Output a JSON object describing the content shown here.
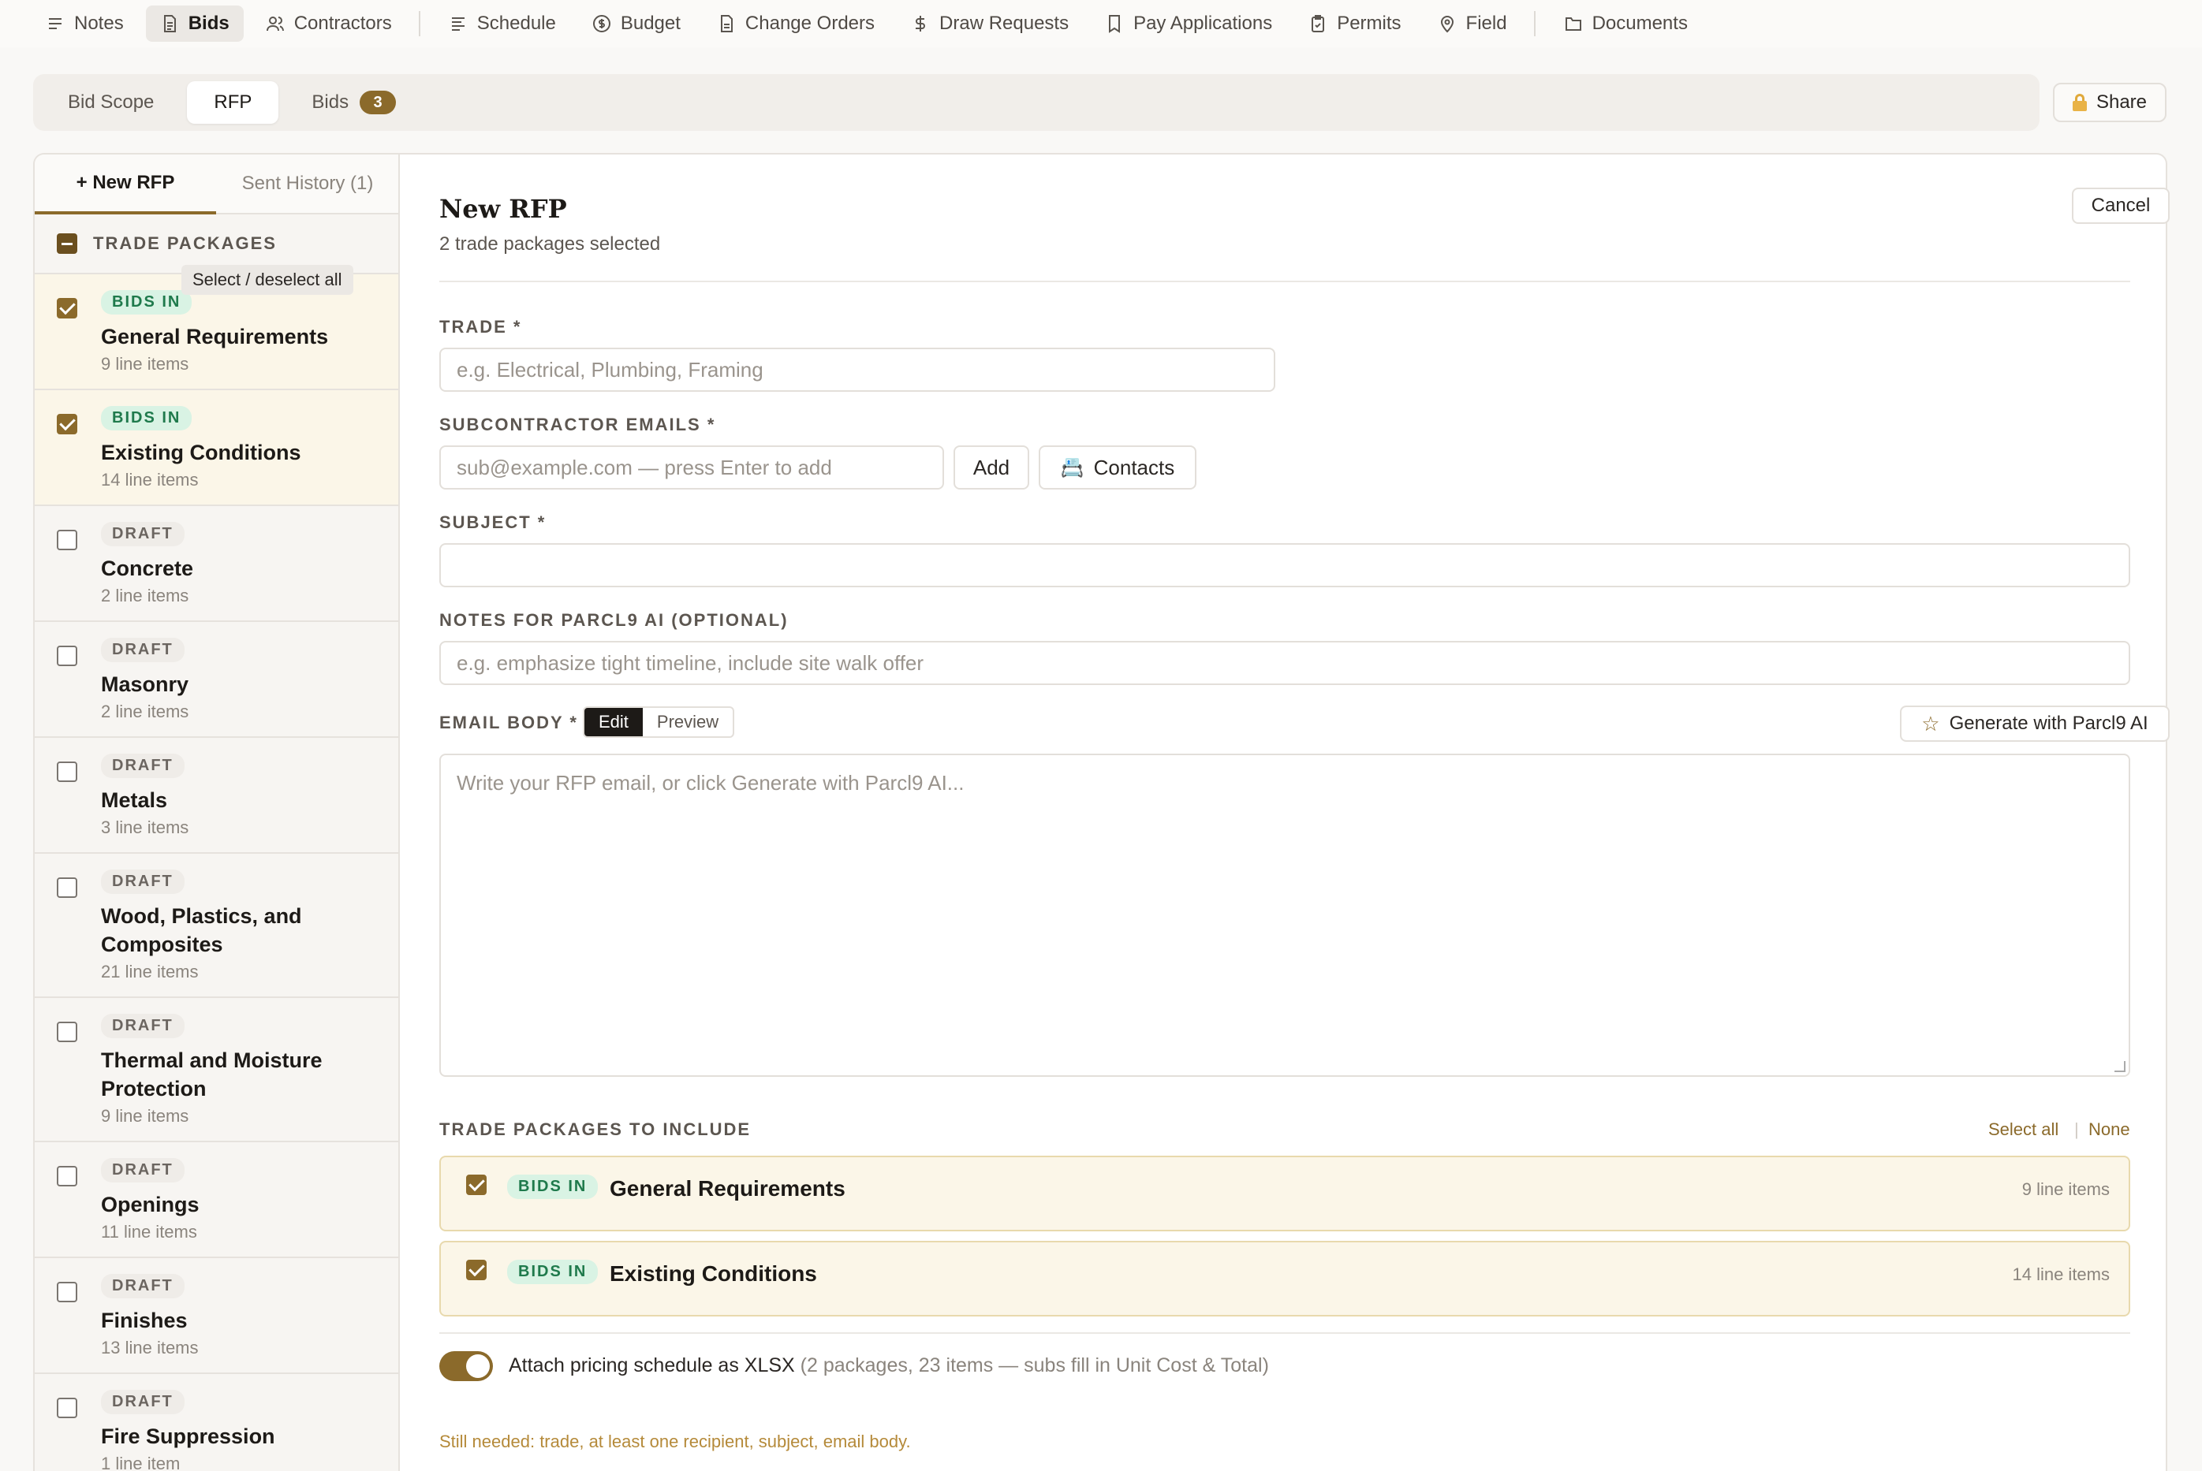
{
  "nav": {
    "items": [
      {
        "label": "Notes",
        "icon": "menu-lines-icon"
      },
      {
        "label": "Bids",
        "icon": "document-icon",
        "active": true
      },
      {
        "label": "Contractors",
        "icon": "users-icon"
      },
      {
        "label": "Schedule",
        "icon": "schedule-lines-icon"
      },
      {
        "label": "Budget",
        "icon": "dollar-circle-icon"
      },
      {
        "label": "Change Orders",
        "icon": "file-icon"
      },
      {
        "label": "Draw Requests",
        "icon": "dollar-icon"
      },
      {
        "label": "Pay Applications",
        "icon": "receipt-icon"
      },
      {
        "label": "Permits",
        "icon": "clipboard-icon"
      },
      {
        "label": "Field",
        "icon": "map-pin-icon"
      },
      {
        "label": "Documents",
        "icon": "folder-icon"
      }
    ]
  },
  "subtabs": {
    "bid_scope": "Bid Scope",
    "rfp": "RFP",
    "bids": "Bids",
    "bids_count": "3"
  },
  "share": {
    "label": "Share"
  },
  "left": {
    "tab_new": "+ New RFP",
    "tab_history": "Sent History (1)",
    "header": "TRADE PACKAGES",
    "tooltip": "Select / deselect all",
    "packages": [
      {
        "status": "BIDS IN",
        "name": "General Requirements",
        "count": "9 line items",
        "checked": true
      },
      {
        "status": "BIDS IN",
        "name": "Existing Conditions",
        "count": "14 line items",
        "checked": true
      },
      {
        "status": "DRAFT",
        "name": "Concrete",
        "count": "2 line items",
        "checked": false
      },
      {
        "status": "DRAFT",
        "name": "Masonry",
        "count": "2 line items",
        "checked": false
      },
      {
        "status": "DRAFT",
        "name": "Metals",
        "count": "3 line items",
        "checked": false
      },
      {
        "status": "DRAFT",
        "name": "Wood, Plastics, and Composites",
        "count": "21 line items",
        "checked": false
      },
      {
        "status": "DRAFT",
        "name": "Thermal and Moisture Protection",
        "count": "9 line items",
        "checked": false
      },
      {
        "status": "DRAFT",
        "name": "Openings",
        "count": "11 line items",
        "checked": false
      },
      {
        "status": "DRAFT",
        "name": "Finishes",
        "count": "13 line items",
        "checked": false
      },
      {
        "status": "DRAFT",
        "name": "Fire Suppression",
        "count": "1 line item",
        "checked": false
      }
    ]
  },
  "form": {
    "title": "New RFP",
    "subtitle": "2 trade packages selected",
    "cancel": "Cancel",
    "trade_label": "TRADE *",
    "trade_placeholder": "e.g. Electrical, Plumbing, Framing",
    "emails_label": "SUBCONTRACTOR EMAILS *",
    "emails_placeholder": "sub@example.com — press Enter to add",
    "add_button": "Add",
    "contacts_button": "Contacts",
    "subject_label": "SUBJECT *",
    "subject_value": "",
    "notes_label": "NOTES FOR PARCL9 AI (OPTIONAL)",
    "notes_placeholder": "e.g. emphasize tight timeline, include site walk offer",
    "body_label": "EMAIL BODY *",
    "edit_tab": "Edit",
    "preview_tab": "Preview",
    "generate_button": "Generate with Parcl9 AI",
    "body_placeholder": "Write your RFP email, or click Generate with Parcl9 AI...",
    "include_label": "TRADE PACKAGES TO INCLUDE",
    "select_all": "Select all",
    "select_none": "None",
    "included": [
      {
        "status": "BIDS IN",
        "name": "General Requirements",
        "count": "9 line items"
      },
      {
        "status": "BIDS IN",
        "name": "Existing Conditions",
        "count": "14 line items"
      }
    ],
    "attach_label": "Attach pricing schedule as XLSX",
    "attach_detail": "(2 packages, 23 items — subs fill in Unit Cost & Total)",
    "attach_on": true,
    "still_needed": "Still needed: trade, at least one recipient, subject, email body."
  }
}
